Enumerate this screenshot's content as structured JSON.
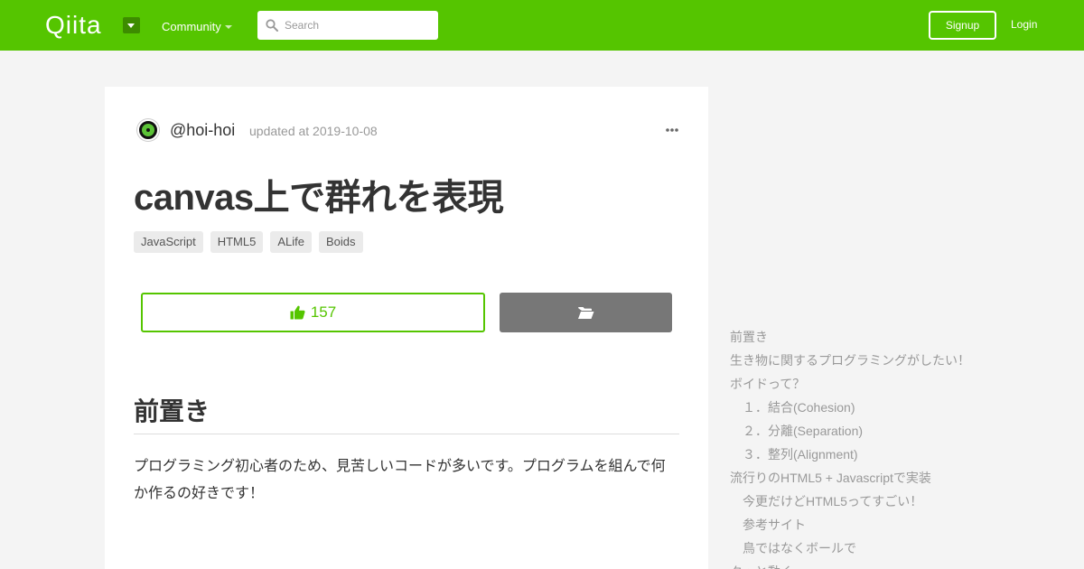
{
  "header": {
    "logo": "Qiita",
    "community": "Community",
    "search_placeholder": "Search",
    "signup": "Signup",
    "login": "Login",
    "brand_color": "#55c500"
  },
  "article": {
    "username": "@hoi-hoi",
    "updated": "updated at 2019-10-08",
    "title": "canvas上で群れを表現",
    "tags": [
      "JavaScript",
      "HTML5",
      "ALife",
      "Boids"
    ],
    "like_count": "157",
    "section_heading": "前置き",
    "paragraph": "プログラミング初心者のため、見苦しいコードが多いです。プログラムを組んで何か作るの好きです！"
  },
  "toc": {
    "items": [
      {
        "label": "前置き",
        "level": 1
      },
      {
        "label": "生き物に関するプログラミングがしたい！",
        "level": 1
      },
      {
        "label": "ボイドって？",
        "level": 1
      },
      {
        "label": "　１．結合(Cohesion)",
        "level": 1
      },
      {
        "label": "　２．分離(Separation)",
        "level": 1
      },
      {
        "label": "　３．整列(Alignment)",
        "level": 1
      },
      {
        "label": "流行りのHTML5 + Javascriptで実装",
        "level": 1
      },
      {
        "label": "今更だけどHTML5ってすごい！",
        "level": 2
      },
      {
        "label": "参考サイト",
        "level": 2
      },
      {
        "label": "鳥ではなくボールで",
        "level": 2
      },
      {
        "label": "クッと動く",
        "level": 1
      }
    ]
  },
  "icons": {
    "search": "search-icon",
    "more": "more-options-icon",
    "like": "thumbs-up-icon",
    "stock": "folder-open-icon"
  }
}
